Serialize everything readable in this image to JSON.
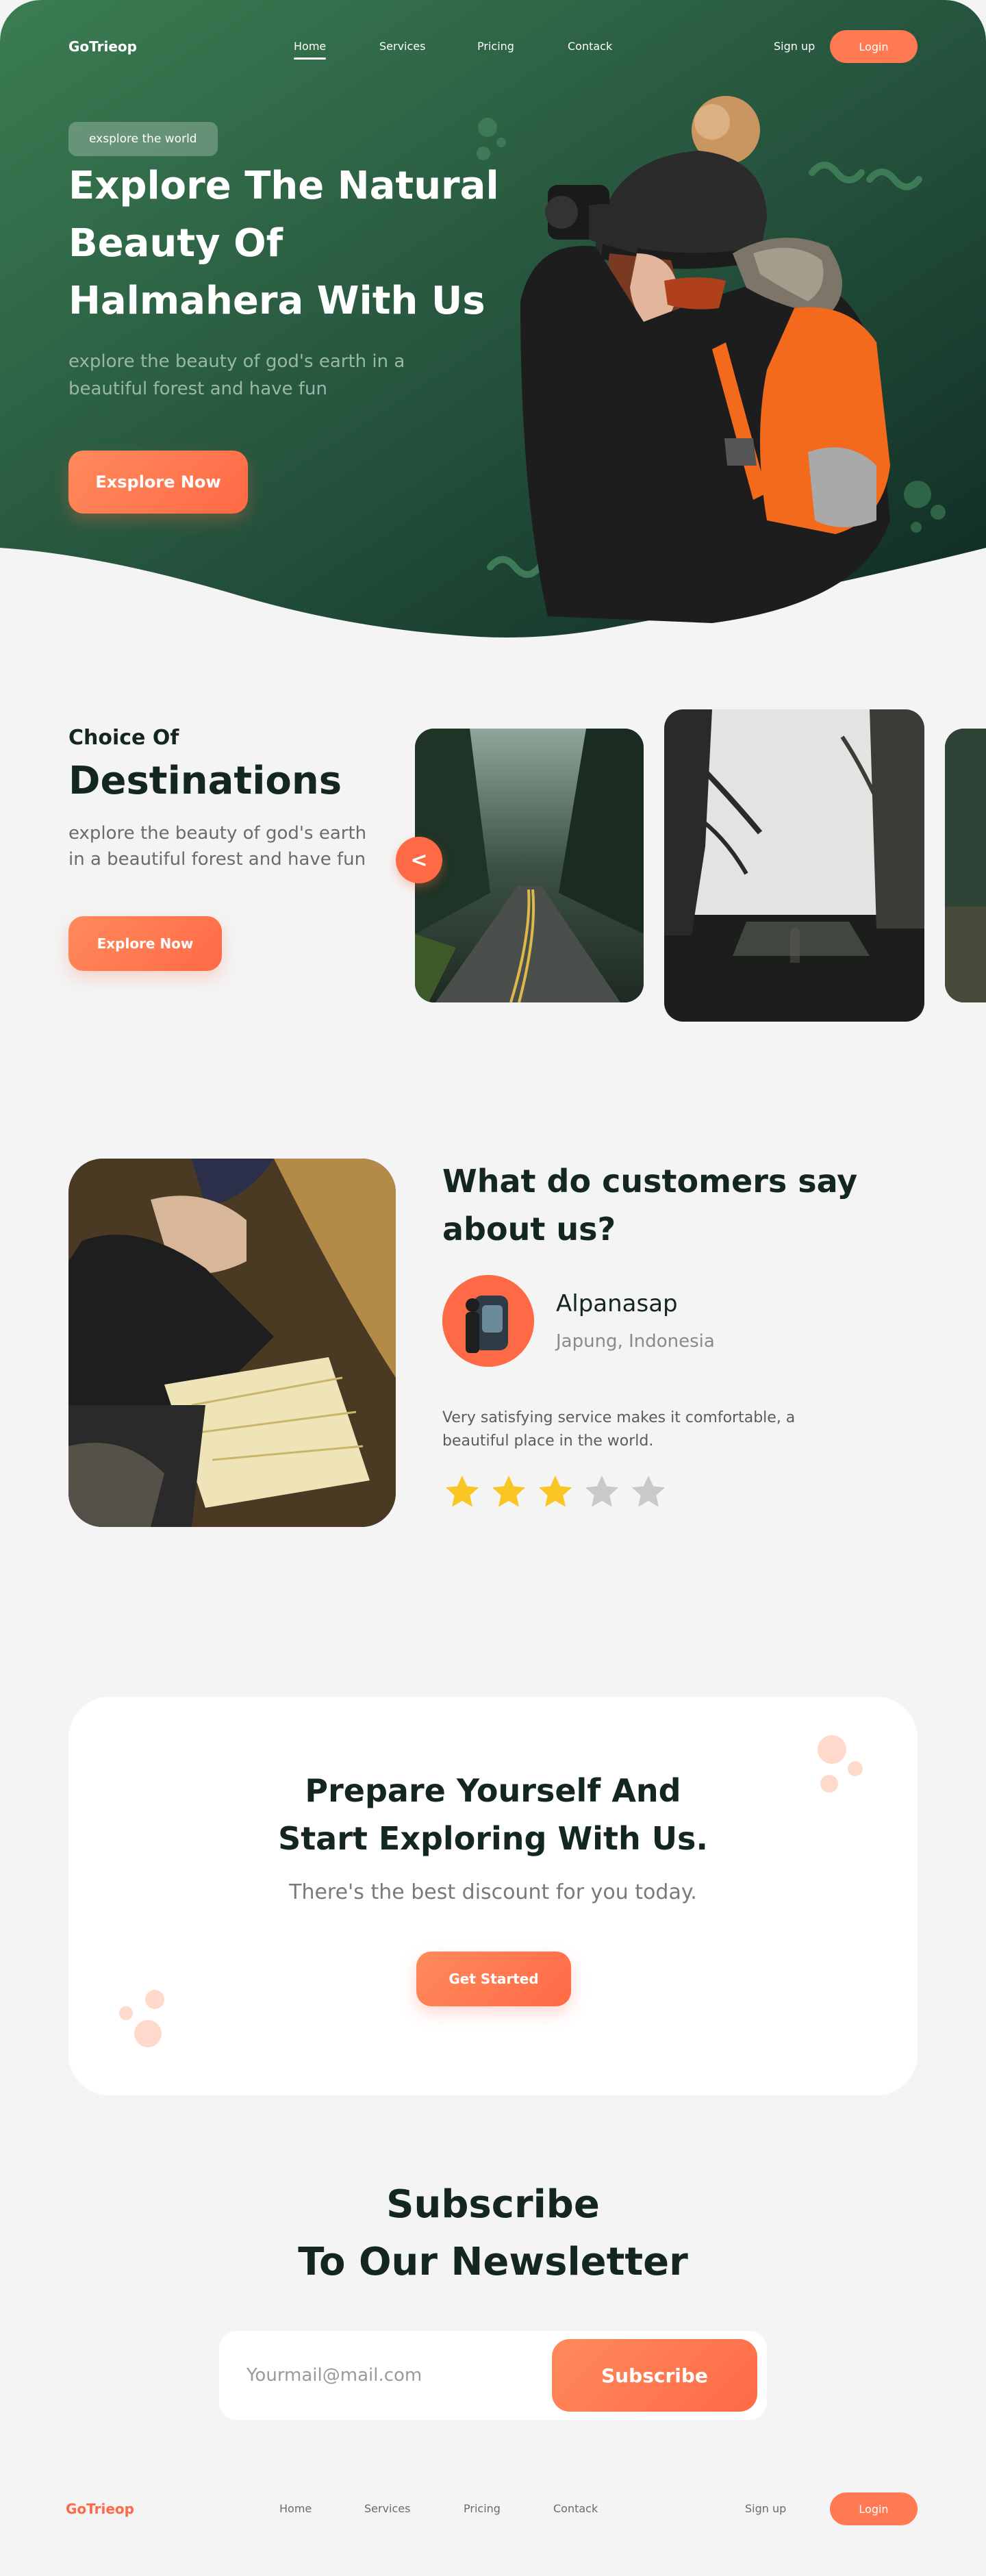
{
  "brand": {
    "logo": "GoTrieop",
    "footer_logo": "GoTrieop",
    "accent": "#ff6a46",
    "dark_green": "#1e3f30"
  },
  "nav": {
    "links": [
      {
        "label": "Home",
        "active": true
      },
      {
        "label": "Services",
        "active": false
      },
      {
        "label": "Pricing",
        "active": false
      },
      {
        "label": "Contack",
        "active": false
      }
    ],
    "signup": "Sign up",
    "login": "Login"
  },
  "hero": {
    "tag": "exsplore the world",
    "title": "Explore The Natural Beauty Of Halmahera With Us",
    "subtitle": "explore the beauty of god's earth in a beautiful forest and have fun",
    "button": "Exsplore Now"
  },
  "destinations": {
    "kicker": "Choice Of",
    "title": "Destinations",
    "subtitle": "explore the beauty of god's earth in a beautiful forest and have fun",
    "button": "Explore Now",
    "prev_icon": "chevron-left-icon",
    "prev_label": "<"
  },
  "testimonial": {
    "title": "What do customers say about us?",
    "name": "Alpanasap",
    "location": "Japung, Indonesia",
    "quote": "Very satisfying service makes it comfortable, a beautiful place in the world.",
    "rating": 3,
    "max_rating": 5,
    "star_color": "#f9c623",
    "star_empty_color": "#c9c9c9"
  },
  "cta": {
    "title_line1": "Prepare Yourself And",
    "title_line2": "Start Exploring With Us.",
    "subtitle": "There's the best discount for you today.",
    "button": "Get Started"
  },
  "newsletter": {
    "title_line1": "Subscribe",
    "title_line2": "To Our Newsletter",
    "placeholder": "Yourmail@mail.com",
    "button": "Subscribe"
  },
  "footer": {
    "links": [
      "Home",
      "Services",
      "Pricing",
      "Contack"
    ],
    "signup": "Sign up",
    "login": "Login"
  }
}
